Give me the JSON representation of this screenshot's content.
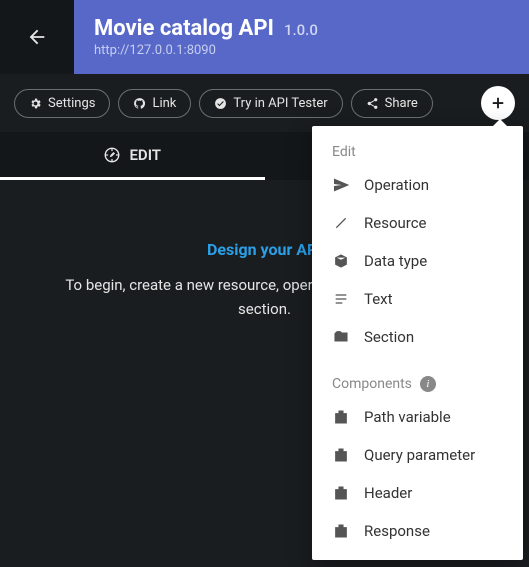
{
  "header": {
    "title": "Movie catalog API",
    "version": "1.0.0",
    "url": "http://127.0.0.1:8090"
  },
  "toolbar": {
    "settings": "Settings",
    "link": "Link",
    "try": "Try in API Tester",
    "share": "Share"
  },
  "tabs": {
    "edit": "EDIT"
  },
  "content": {
    "design_line": "Design your API",
    "hint_l1": "To begin, create a new resource, operation, data type, text or",
    "hint_l2": "section."
  },
  "menu": {
    "heading_edit": "Edit",
    "heading_components": "Components",
    "items_edit": {
      "operation": "Operation",
      "resource": "Resource",
      "datatype": "Data type",
      "text": "Text",
      "section": "Section"
    },
    "items_components": {
      "path_var": "Path variable",
      "query_param": "Query parameter",
      "header": "Header",
      "response": "Response"
    }
  }
}
